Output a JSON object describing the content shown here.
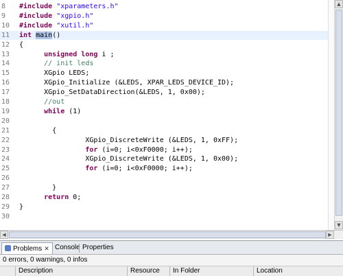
{
  "editor": {
    "lines": [
      {
        "num": "8",
        "segments": [
          {
            "t": "#include ",
            "c": "kw"
          },
          {
            "t": "\"xparameters.h\"",
            "c": "str"
          }
        ]
      },
      {
        "num": "9",
        "segments": [
          {
            "t": "#include ",
            "c": "kw"
          },
          {
            "t": "\"xgpio.h\"",
            "c": "str"
          }
        ]
      },
      {
        "num": "10",
        "segments": [
          {
            "t": "#include ",
            "c": "kw"
          },
          {
            "t": "\"xutil.h\"",
            "c": "str"
          }
        ]
      },
      {
        "num": "11",
        "current": true,
        "segments": [
          {
            "t": "int ",
            "c": "kw"
          },
          {
            "t": "main",
            "c": "sel"
          },
          {
            "t": "()",
            "c": ""
          }
        ]
      },
      {
        "num": "12",
        "segments": [
          {
            "t": "{",
            "c": ""
          }
        ]
      },
      {
        "num": "13",
        "segments": [
          {
            "t": "      ",
            "c": ""
          },
          {
            "t": "unsigned long",
            "c": "kw"
          },
          {
            "t": " i ;",
            "c": ""
          }
        ]
      },
      {
        "num": "14",
        "segments": [
          {
            "t": "      ",
            "c": ""
          },
          {
            "t": "// init leds",
            "c": "cm"
          }
        ]
      },
      {
        "num": "15",
        "segments": [
          {
            "t": "      XGpio LEDS;",
            "c": ""
          }
        ]
      },
      {
        "num": "16",
        "segments": [
          {
            "t": "      XGpio_Initialize (&LEDS, XPAR_LEDS_DEVICE_ID);",
            "c": ""
          }
        ]
      },
      {
        "num": "17",
        "segments": [
          {
            "t": "      XGpio_SetDataDirection(&LEDS, 1, 0x00);",
            "c": ""
          }
        ]
      },
      {
        "num": "18",
        "segments": [
          {
            "t": "      ",
            "c": ""
          },
          {
            "t": "//out",
            "c": "cm"
          }
        ]
      },
      {
        "num": "19",
        "segments": [
          {
            "t": "      ",
            "c": ""
          },
          {
            "t": "while",
            "c": "kw"
          },
          {
            "t": " (1)",
            "c": ""
          }
        ]
      },
      {
        "num": "20",
        "segments": [
          {
            "t": "",
            "c": ""
          }
        ]
      },
      {
        "num": "21",
        "segments": [
          {
            "t": "        {",
            "c": ""
          }
        ]
      },
      {
        "num": "22",
        "segments": [
          {
            "t": "                XGpio_DiscreteWrite (&LEDS, 1, 0xFF);",
            "c": ""
          }
        ]
      },
      {
        "num": "23",
        "segments": [
          {
            "t": "                ",
            "c": ""
          },
          {
            "t": "for",
            "c": "kw"
          },
          {
            "t": " (i=0; i<0xF0000; i++);",
            "c": ""
          }
        ]
      },
      {
        "num": "24",
        "segments": [
          {
            "t": "                XGpio_DiscreteWrite (&LEDS, 1, 0x00);",
            "c": ""
          }
        ]
      },
      {
        "num": "25",
        "segments": [
          {
            "t": "                ",
            "c": ""
          },
          {
            "t": "for",
            "c": "kw"
          },
          {
            "t": " (i=0; i<0xF0000; i++);",
            "c": ""
          }
        ]
      },
      {
        "num": "26",
        "segments": [
          {
            "t": "",
            "c": ""
          }
        ]
      },
      {
        "num": "27",
        "segments": [
          {
            "t": "        }",
            "c": ""
          }
        ]
      },
      {
        "num": "28",
        "segments": [
          {
            "t": "      ",
            "c": ""
          },
          {
            "t": "return",
            "c": "kw"
          },
          {
            "t": " 0;",
            "c": ""
          }
        ]
      },
      {
        "num": "29",
        "segments": [
          {
            "t": "}",
            "c": ""
          }
        ]
      },
      {
        "num": "30",
        "segments": [
          {
            "t": "",
            "c": ""
          }
        ]
      }
    ]
  },
  "panel": {
    "tabs": [
      {
        "label": "Problems",
        "active": true,
        "icon": "problems-icon",
        "closable": true
      },
      {
        "label": "Console",
        "active": false
      },
      {
        "label": "Properties",
        "active": false
      }
    ],
    "summary": "0 errors, 0 warnings, 0 infos",
    "columns": [
      "Description",
      "Resource",
      "In Folder",
      "Location"
    ]
  },
  "colors": {
    "keyword": "#7f0055",
    "string": "#2a00ff",
    "comment": "#3f7f5f",
    "current_line": "#e8f2fe",
    "selection": "#b0c4e8"
  }
}
